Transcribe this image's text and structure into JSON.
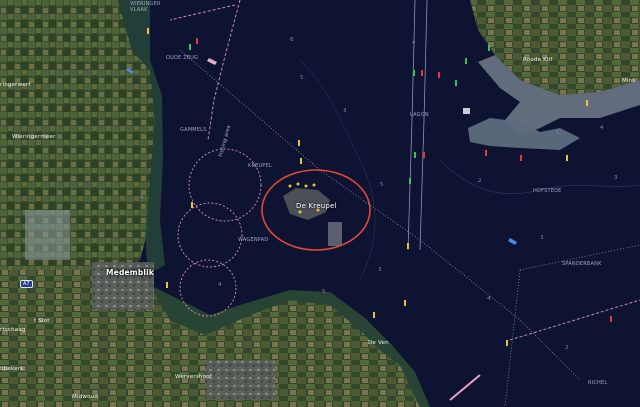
{
  "map": {
    "labels": {
      "wieringer_vlaak": "WIERINGER\nVLAAK",
      "oude_zeug": "OUDE ZEUG",
      "wieringerwerf": "ringerwerf",
      "wieringermeer": "Wieringermeer",
      "gammels": "GAMMELS",
      "fishing_area": "Fishing area",
      "kreupel_channel": "KREUPEL",
      "wagenpad": "WAGENPAD",
      "de_kreupel": "De Kreupel",
      "lagon": "LAGON",
      "roode_klif": "Roode Klif",
      "hofstede": "HOFSTEDE",
      "spanderbank": "SPANDERBANK",
      "medemblik": "Medemblik",
      "t_slot": "t Slot",
      "schaag": "rtschaag",
      "abbekerk": "bbekerk",
      "wervershoof": "Wervershoof",
      "midwoud": "Midwoud",
      "de_ven": "De Ven",
      "richel": "RICHEL",
      "minsterland": "Mins",
      "road_shield": "A7"
    },
    "depths": {
      "d1": "6",
      "d2": "5",
      "d3": "4",
      "d4": "3",
      "d5": "5",
      "d6": "4",
      "d7": "5",
      "d8": "4",
      "d9": "3",
      "d10": "2",
      "d11": "4",
      "d12": "4",
      "d13": "3",
      "d14": "1",
      "d15": "2",
      "d16": "3"
    },
    "colors": {
      "water": "#0d1330",
      "shallow_water": "#6c7a8c",
      "land": "#3d5230",
      "fishing_area_line": "#c889a8",
      "highlight_circle": "#e0493a",
      "fairway_line": "#8a93b8"
    },
    "icons": {
      "red_buoy": "red-buoy-icon",
      "green_buoy": "green-buoy-icon",
      "yellow_buoy": "yellow-buoy-icon",
      "vessel": "vessel-icon",
      "wind_turbine": "wind-turbine-icon"
    }
  }
}
